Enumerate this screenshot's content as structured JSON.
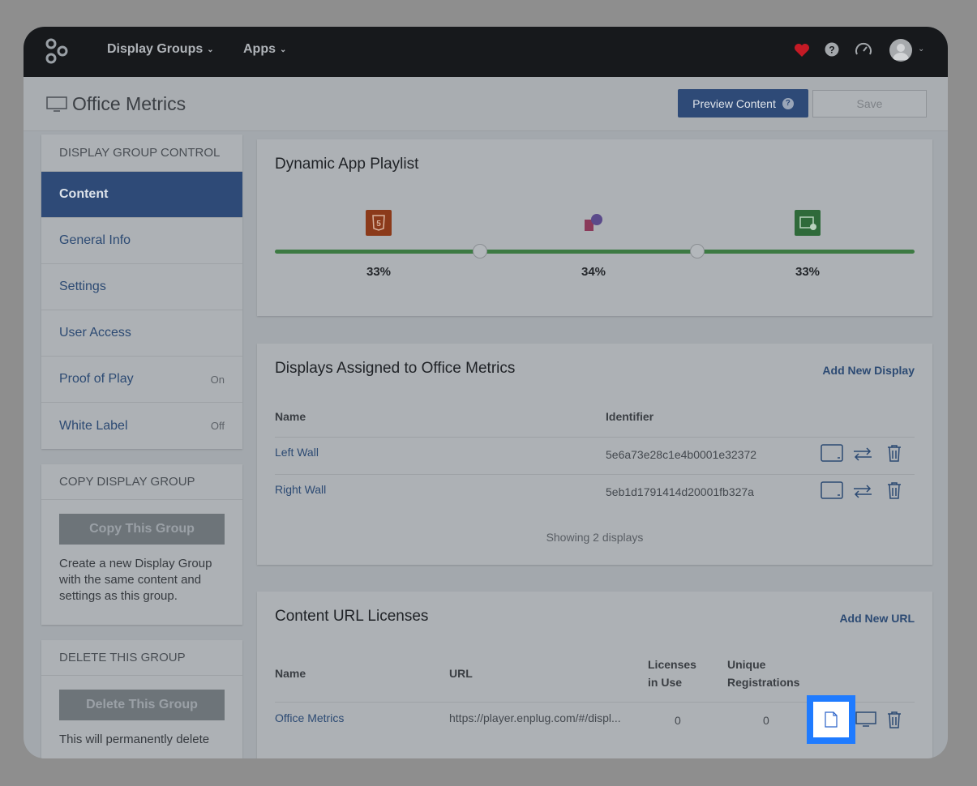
{
  "nav": {
    "display_groups": "Display Groups",
    "apps": "Apps"
  },
  "header": {
    "title": "Office Metrics",
    "preview_label": "Preview Content",
    "save_label": "Save"
  },
  "sidebar": {
    "control_title": "DISPLAY GROUP CONTROL",
    "items": [
      {
        "label": "Content",
        "state": ""
      },
      {
        "label": "General Info",
        "state": ""
      },
      {
        "label": "Settings",
        "state": ""
      },
      {
        "label": "User Access",
        "state": ""
      },
      {
        "label": "Proof of Play",
        "state": "On"
      },
      {
        "label": "White Label",
        "state": "Off"
      }
    ],
    "copy": {
      "title": "COPY DISPLAY GROUP",
      "button": "Copy This Group",
      "text": "Create a new Display Group with the same content and settings as this group."
    },
    "delete": {
      "title": "DELETE THIS GROUP",
      "button": "Delete This Group",
      "text": "This will permanently delete"
    }
  },
  "playlist": {
    "title": "Dynamic App Playlist",
    "apps": [
      {
        "icon": "html5-app-icon",
        "percent": 33,
        "label": "33%",
        "color": "#8b3a1a"
      },
      {
        "icon": "social-app-icon",
        "percent": 34,
        "label": "34%",
        "color": "#7a3d6b"
      },
      {
        "icon": "image-gallery-app-icon",
        "percent": 33,
        "label": "33%",
        "color": "#2f6a3a"
      }
    ],
    "track_color": "#3d7a43"
  },
  "displays": {
    "title": "Displays Assigned to Office Metrics",
    "add_link": "Add New Display",
    "columns": {
      "name": "Name",
      "identifier": "Identifier"
    },
    "rows": [
      {
        "name": "Left Wall",
        "identifier": "5e6a73e28c1e4b0001e32372"
      },
      {
        "name": "Right Wall",
        "identifier": "5eb1d1791414d20001fb327a"
      }
    ],
    "footer": "Showing 2 displays"
  },
  "licenses": {
    "title": "Content URL Licenses",
    "add_link": "Add New URL",
    "columns": {
      "name": "Name",
      "url": "URL",
      "licenses_line1": "Licenses",
      "licenses_line2": "in Use",
      "unique_line1": "Unique",
      "unique_line2": "Registrations"
    },
    "rows": [
      {
        "name": "Office Metrics",
        "url": "https://player.enplug.com/#/displ...",
        "licenses": "0",
        "unique": "0"
      }
    ]
  },
  "colors": {
    "accent": "#2e4a77",
    "highlight": "#1f7bff",
    "heart": "#c41a25"
  }
}
